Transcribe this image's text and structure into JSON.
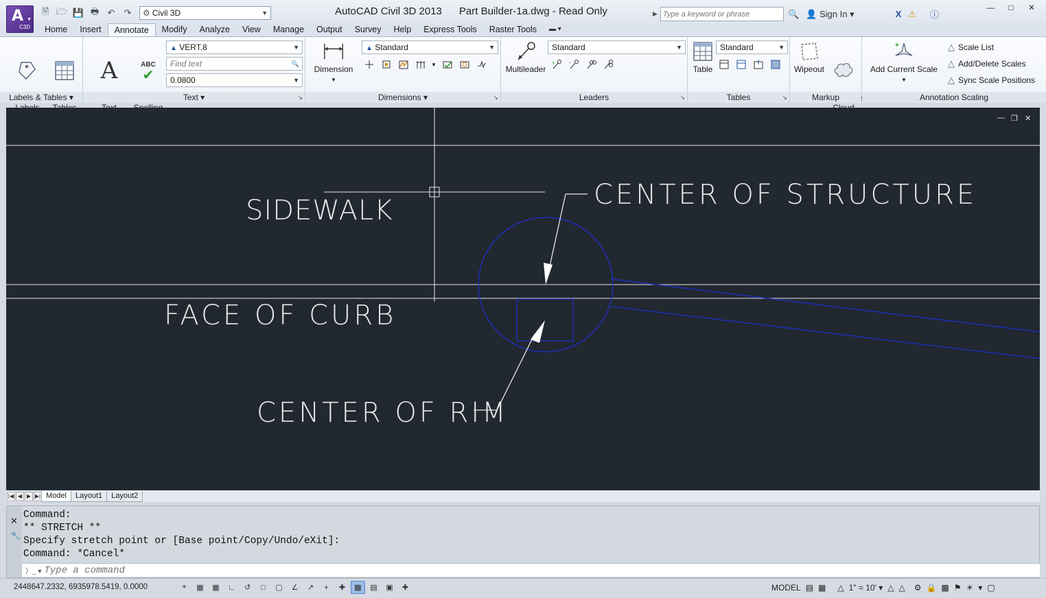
{
  "app": {
    "logo_text": "A",
    "logo_sub": "C3D",
    "title": "AutoCAD Civil 3D 2013      Part Builder-1a.dwg - Read Only"
  },
  "quick_access": {
    "workspace": "Civil 3D"
  },
  "search": {
    "placeholder": "Type a keyword or phrase"
  },
  "account": {
    "sign_in": "Sign In"
  },
  "ribbon_tabs": [
    {
      "label": "Home"
    },
    {
      "label": "Insert"
    },
    {
      "label": "Annotate"
    },
    {
      "label": "Modify"
    },
    {
      "label": "Analyze"
    },
    {
      "label": "View"
    },
    {
      "label": "Manage"
    },
    {
      "label": "Output"
    },
    {
      "label": "Survey"
    },
    {
      "label": "Help"
    },
    {
      "label": "Express Tools"
    },
    {
      "label": "Raster Tools"
    }
  ],
  "active_tab": "Annotate",
  "panels": {
    "labels_tables": {
      "title": "Labels & Tables",
      "add_labels": "Add\nLabels",
      "add_tables": "Add\nTables"
    },
    "text": {
      "title": "Text",
      "multiline": "Multiline\nText",
      "check_spelling": "Check\nSpelling",
      "spell_icon_text": "ABC",
      "style": "VERT.8",
      "find_placeholder": "Find text",
      "height": "0.0800"
    },
    "dimensions": {
      "title": "Dimensions",
      "dimension": "Dimension",
      "style": "Standard"
    },
    "leaders": {
      "title": "Leaders",
      "multileader": "Multileader",
      "style": "Standard"
    },
    "tables": {
      "title": "Tables",
      "table": "Table",
      "style": "Standard"
    },
    "markup": {
      "title": "Markup",
      "wipeout": "Wipeout",
      "revision_cloud": "Revision\nCloud"
    },
    "annotation_scaling": {
      "title": "Annotation Scaling",
      "add_current_scale": "Add Current Scale",
      "scale_list": "Scale List",
      "add_delete_scales": "Add/Delete Scales",
      "sync_scale_positions": "Sync Scale Positions"
    }
  },
  "drawing": {
    "labels": {
      "sidewalk": "SIDEWALK",
      "face_of_curb": "FACE OF CURB",
      "center_of_structure": "CENTER OF STRUCTURE",
      "center_of_rim": "CENTER OF RIM"
    },
    "colors": {
      "background": "#212830",
      "linework": "#e8e8e8",
      "structure": "#1e2fb5"
    }
  },
  "layout_tabs": [
    {
      "label": "Model",
      "active": true
    },
    {
      "label": "Layout1",
      "active": false
    },
    {
      "label": "Layout2",
      "active": false
    }
  ],
  "command_window": {
    "history": [
      "Command:",
      "** STRETCH **",
      "Specify stretch point or [Base point/Copy/Undo/eXit]:",
      "Command: *Cancel*"
    ],
    "placeholder": "Type a command"
  },
  "status_bar": {
    "coordinates": "2448647.2332, 6935978.5419, 0.0000",
    "space": "MODEL",
    "annotation_scale": "1\" = 10'"
  }
}
